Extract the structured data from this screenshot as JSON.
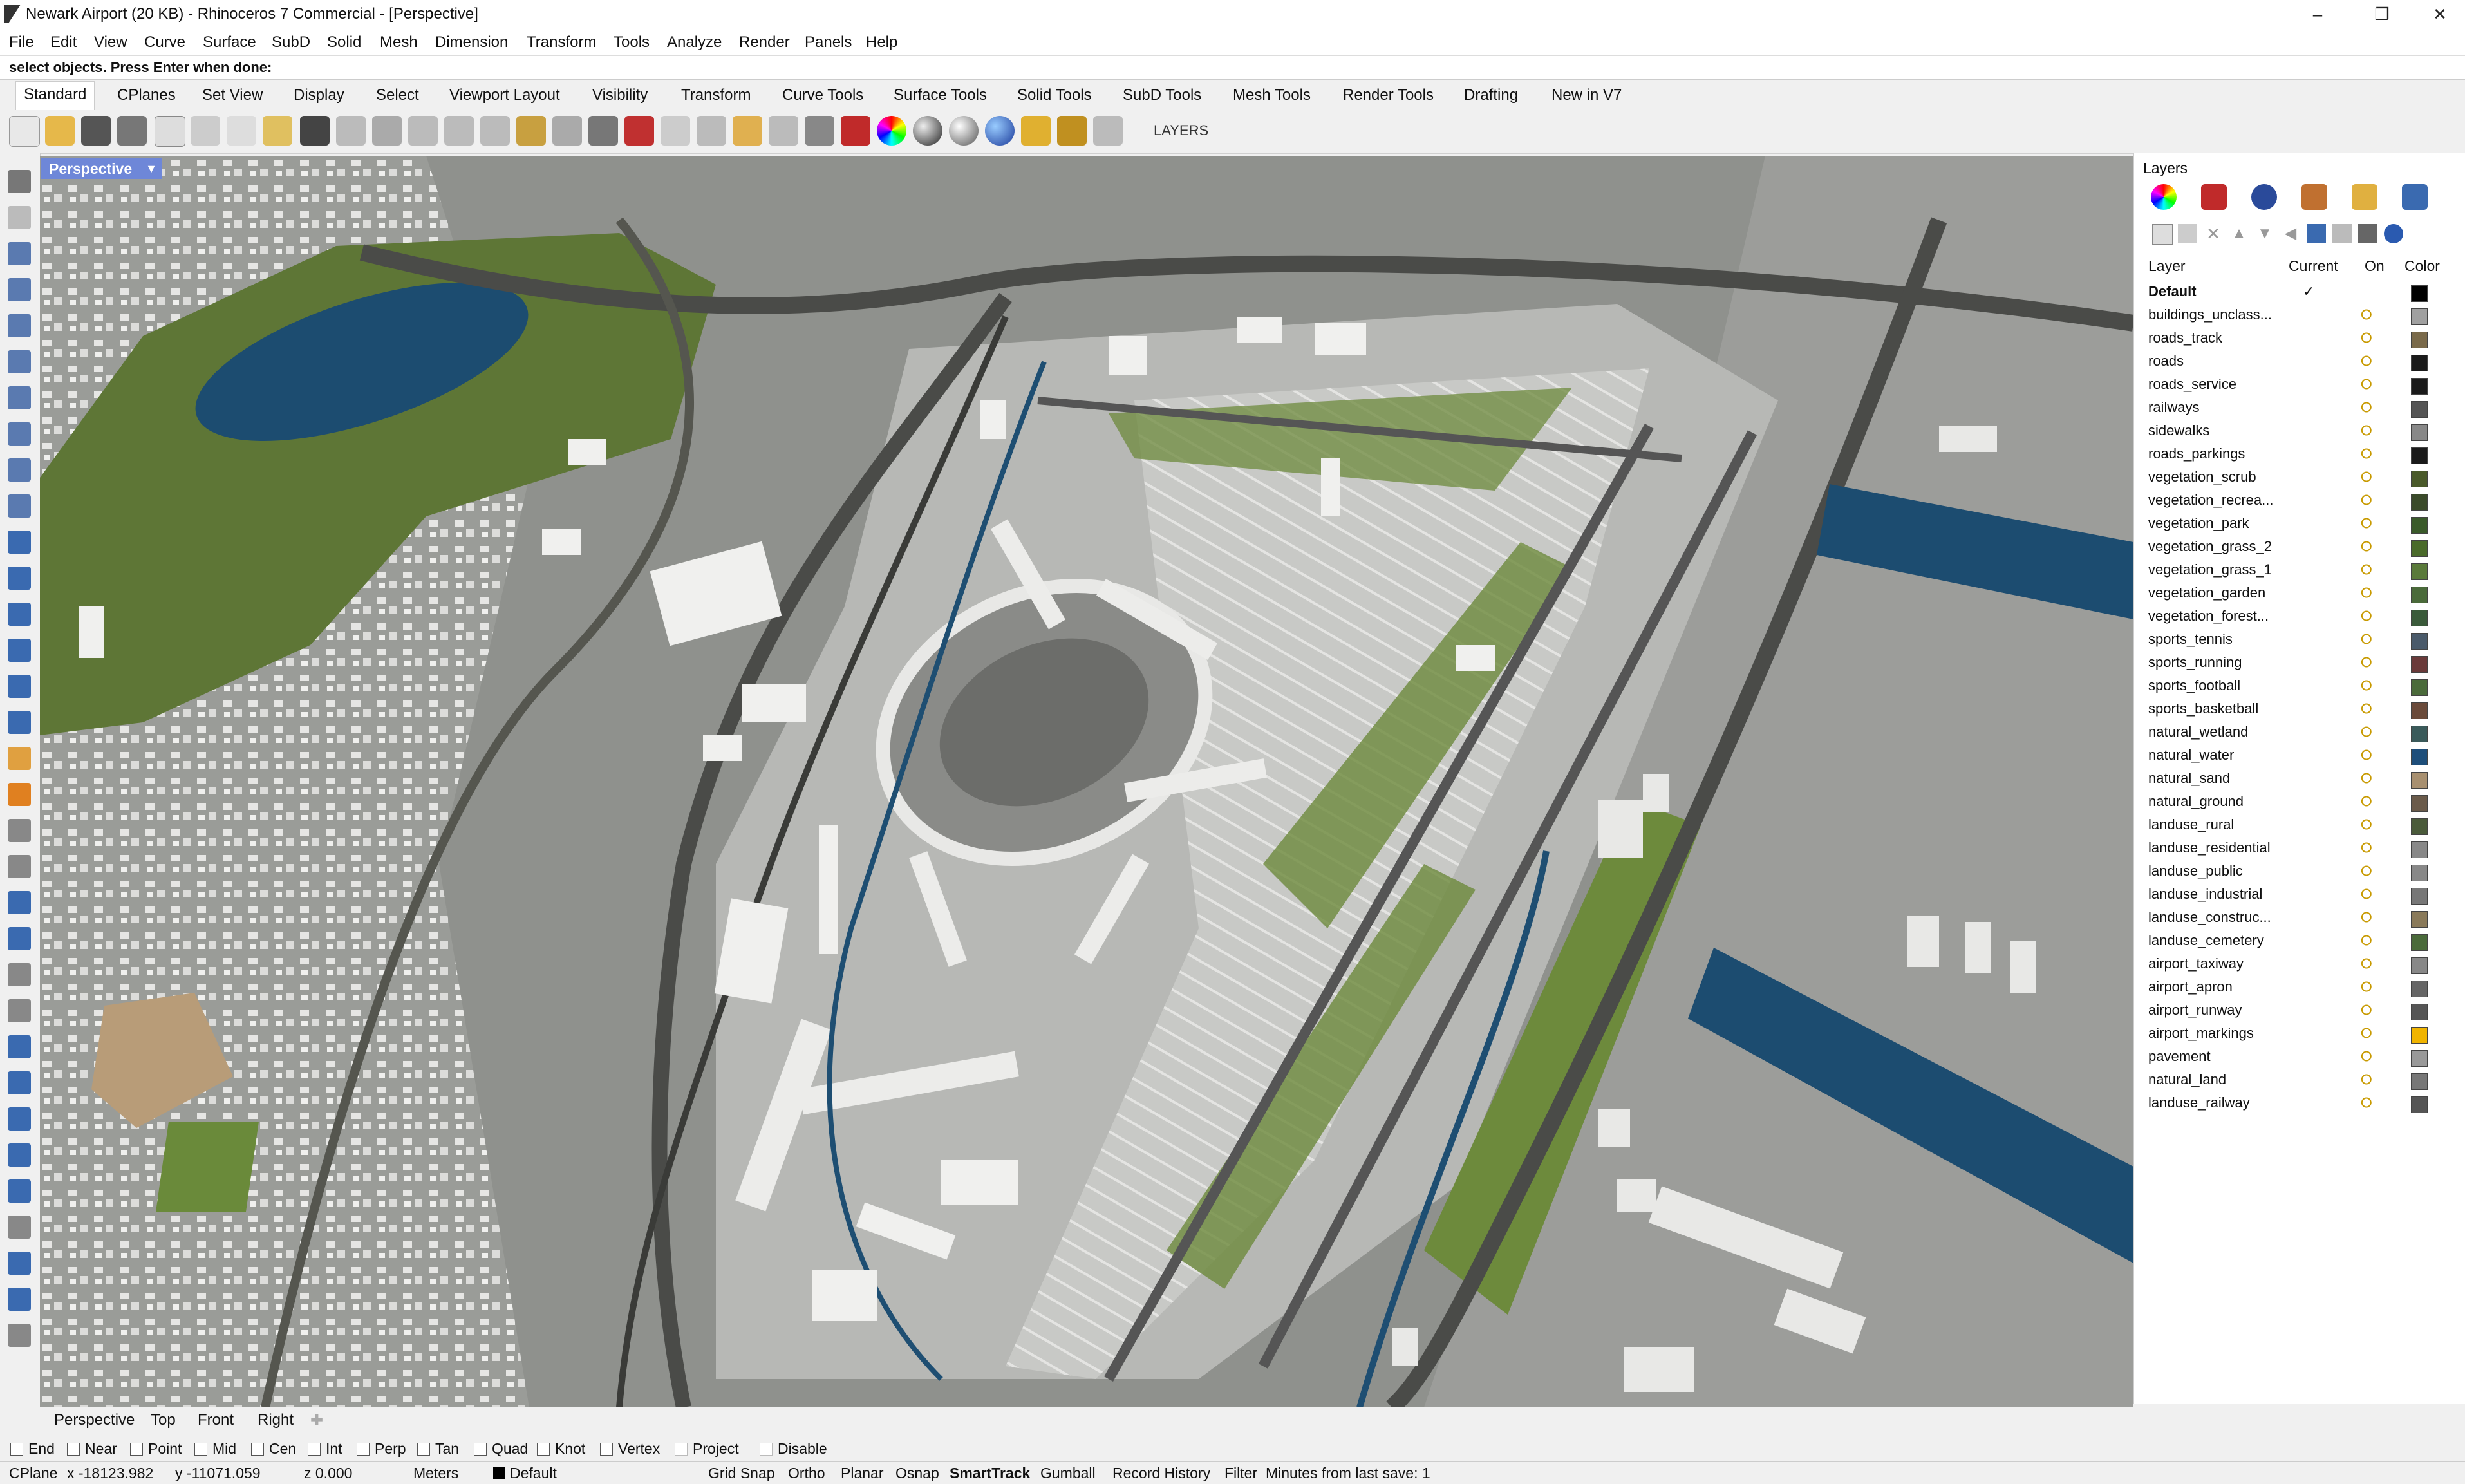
{
  "window": {
    "title": "Newark Airport (20 KB) - Rhinoceros 7 Commercial - [Perspective]"
  },
  "menu": [
    "File",
    "Edit",
    "View",
    "Curve",
    "Surface",
    "SubD",
    "Solid",
    "Mesh",
    "Dimension",
    "Transform",
    "Tools",
    "Analyze",
    "Render",
    "Panels",
    "Help"
  ],
  "command": {
    "prompt": "select objects. Press Enter when done:"
  },
  "tabs": [
    "Standard",
    "CPlanes",
    "Set View",
    "Display",
    "Select",
    "Viewport Layout",
    "Visibility",
    "Transform",
    "Curve Tools",
    "Surface Tools",
    "Solid Tools",
    "SubD Tools",
    "Mesh Tools",
    "Render Tools",
    "Drafting",
    "New in V7"
  ],
  "toolbar": {
    "layers_label": "LAYERS"
  },
  "viewport": {
    "label": "Perspective"
  },
  "panel": {
    "title": "Layers",
    "col_layer": "Layer",
    "col_current": "Current",
    "col_on": "On",
    "col_color": "Color",
    "layers": [
      {
        "name": "Default",
        "color": "#000000",
        "current": true
      },
      {
        "name": "buildings_unclass...",
        "color": "#a0a0a0"
      },
      {
        "name": "roads_track",
        "color": "#7a6a4a"
      },
      {
        "name": "roads",
        "color": "#1a1a1a"
      },
      {
        "name": "roads_service",
        "color": "#1a1a1a"
      },
      {
        "name": "railways",
        "color": "#555555"
      },
      {
        "name": "sidewalks",
        "color": "#888888"
      },
      {
        "name": "roads_parkings",
        "color": "#1a1a1a"
      },
      {
        "name": "vegetation_scrub",
        "color": "#4a5a2a"
      },
      {
        "name": "vegetation_recrea...",
        "color": "#3a4a2a"
      },
      {
        "name": "vegetation_park",
        "color": "#3a5a2a"
      },
      {
        "name": "vegetation_grass_2",
        "color": "#4a6a2a"
      },
      {
        "name": "vegetation_grass_1",
        "color": "#5a7a3a"
      },
      {
        "name": "vegetation_garden",
        "color": "#4a6a3a"
      },
      {
        "name": "vegetation_forest...",
        "color": "#3a5a3a"
      },
      {
        "name": "sports_tennis",
        "color": "#4a5a6a"
      },
      {
        "name": "sports_running",
        "color": "#6a3a3a"
      },
      {
        "name": "sports_football",
        "color": "#4a6a3a"
      },
      {
        "name": "sports_basketball",
        "color": "#6a4a3a"
      },
      {
        "name": "natural_wetland",
        "color": "#3a5a5a"
      },
      {
        "name": "natural_water",
        "color": "#1e4e7a"
      },
      {
        "name": "natural_sand",
        "color": "#a89070"
      },
      {
        "name": "natural_ground",
        "color": "#6a5a4a"
      },
      {
        "name": "landuse_rural",
        "color": "#4a5a3a"
      },
      {
        "name": "landuse_residential",
        "color": "#888888"
      },
      {
        "name": "landuse_public",
        "color": "#888888"
      },
      {
        "name": "landuse_industrial",
        "color": "#777777"
      },
      {
        "name": "landuse_construc...",
        "color": "#8a7a5a"
      },
      {
        "name": "landuse_cemetery",
        "color": "#4a6a3a"
      },
      {
        "name": "airport_taxiway",
        "color": "#888888"
      },
      {
        "name": "airport_apron",
        "color": "#666666"
      },
      {
        "name": "airport_runway",
        "color": "#555555"
      },
      {
        "name": "airport_markings",
        "color": "#f0b400"
      },
      {
        "name": "pavement",
        "color": "#999999"
      },
      {
        "name": "natural_land",
        "color": "#777777"
      },
      {
        "name": "landuse_railway",
        "color": "#555555"
      }
    ]
  },
  "viewtabs": [
    "Perspective",
    "Top",
    "Front",
    "Right"
  ],
  "osnap": [
    "End",
    "Near",
    "Point",
    "Mid",
    "Cen",
    "Int",
    "Perp",
    "Tan",
    "Quad",
    "Knot",
    "Vertex",
    "Project",
    "Disable"
  ],
  "status": {
    "cplane": "CPlane",
    "x": "x -18123.982",
    "y": "y -11071.059",
    "z": "z 0.000",
    "units": "Meters",
    "layer": "Default",
    "grid_snap": "Grid Snap",
    "ortho": "Ortho",
    "planar": "Planar",
    "osnap": "Osnap",
    "smarttrack": "SmartTrack",
    "gumball": "Gumball",
    "record_history": "Record History",
    "filter": "Filter",
    "save_info": "Minutes from last save: 1"
  }
}
